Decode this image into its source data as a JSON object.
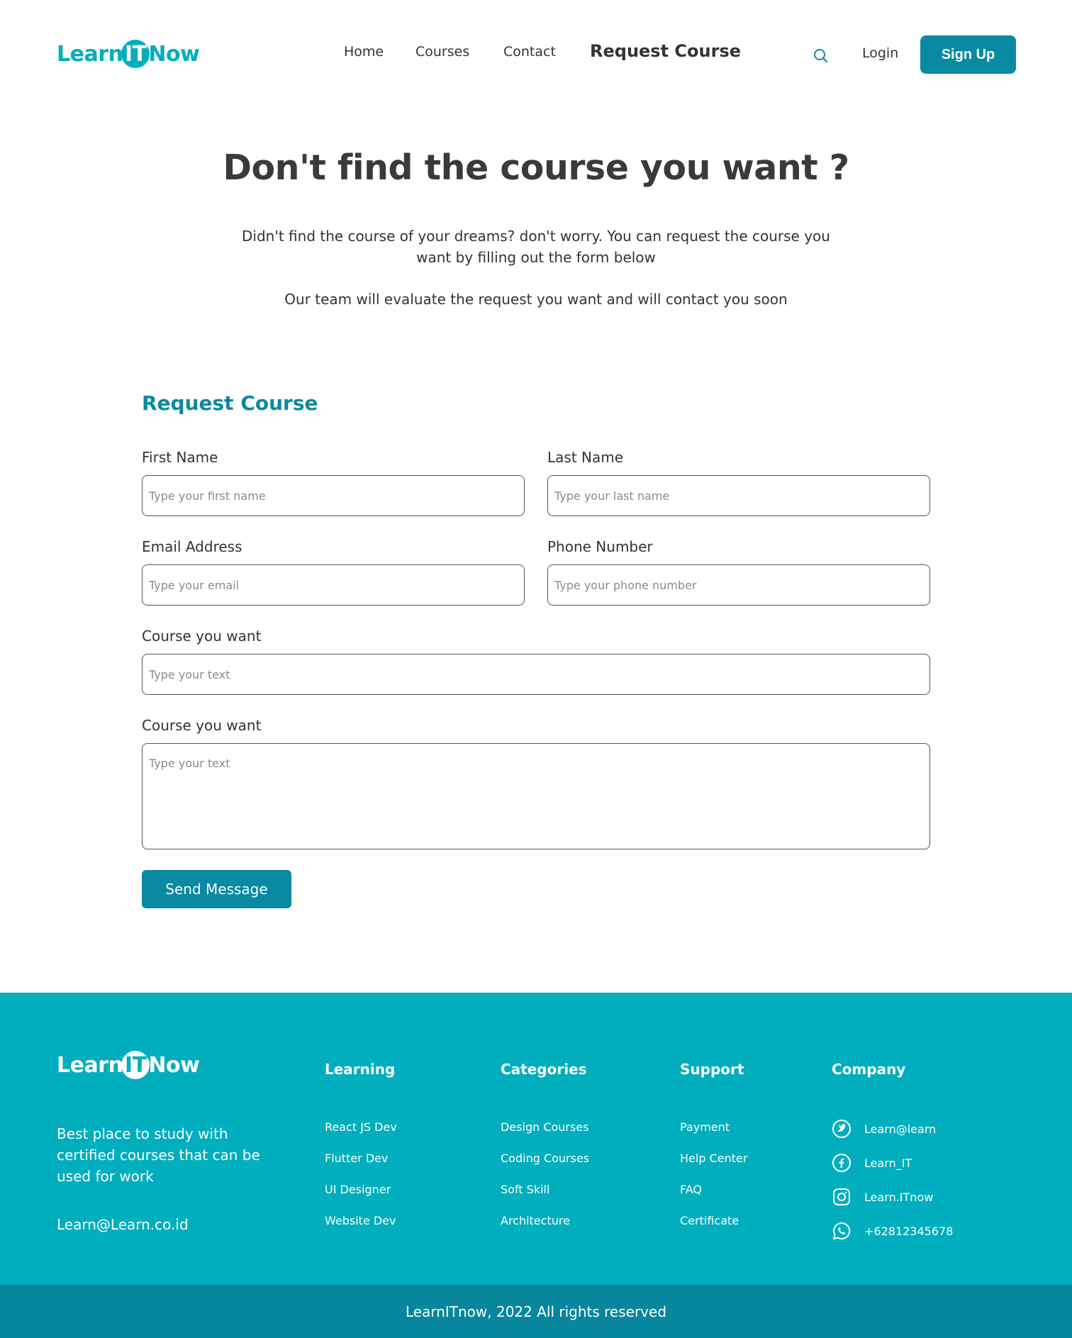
{
  "brand": {
    "part1": "Learn",
    "part2": "IT",
    "part3": "Now"
  },
  "nav": {
    "home": "Home",
    "courses": "Courses",
    "contact": "Contact",
    "request": "Request Course",
    "login": "Login",
    "signup": "Sign Up"
  },
  "hero": {
    "title": "Don't find the course you want ?",
    "description": "Didn't find the course of your dreams? don't worry. You can request the course you want by filling out the form below",
    "note": "Our team will evaluate the request you want and will contact you soon"
  },
  "form": {
    "title": "Request Course",
    "first_name": {
      "label": "First Name",
      "placeholder": "Type your first name"
    },
    "last_name": {
      "label": "Last Name",
      "placeholder": "Type your last name"
    },
    "email": {
      "label": "Email Address",
      "placeholder": "Type your email"
    },
    "phone": {
      "label": "Phone Number",
      "placeholder": "Type your phone number"
    },
    "course": {
      "label": "Course you want",
      "placeholder": "Type your text"
    },
    "message": {
      "label": "Course you want",
      "placeholder": "Type your text"
    },
    "submit": "Send Message"
  },
  "footer": {
    "tagline": "Best place to study with certified courses that can be used for work",
    "email": "Learn@Learn.co.id",
    "learning": {
      "title": "Learning",
      "items": [
        "React JS Dev",
        "Flutter Dev",
        "UI Designer",
        "Website Dev"
      ]
    },
    "categories": {
      "title": "Categories",
      "items": [
        "Design Courses",
        "Coding Courses",
        "Soft Skill",
        "Architecture"
      ]
    },
    "support": {
      "title": "Support",
      "items": [
        "Payment",
        "Help Center",
        "FAQ",
        "Certificate"
      ]
    },
    "company": {
      "title": "Company",
      "items": [
        {
          "icon": "twitter-icon",
          "label": "Learn@learn"
        },
        {
          "icon": "facebook-icon",
          "label": "Learn_IT"
        },
        {
          "icon": "instagram-icon",
          "label": "Learn.ITnow"
        },
        {
          "icon": "whatsapp-icon",
          "label": "+62812345678"
        }
      ]
    },
    "copyright": "LearnITnow, 2022 All rights reserved"
  },
  "colors": {
    "teal": "#00AEBE",
    "dark_teal": "#0989A2",
    "heading_teal": "#0A8AA0",
    "text": "#3a3a3a"
  }
}
